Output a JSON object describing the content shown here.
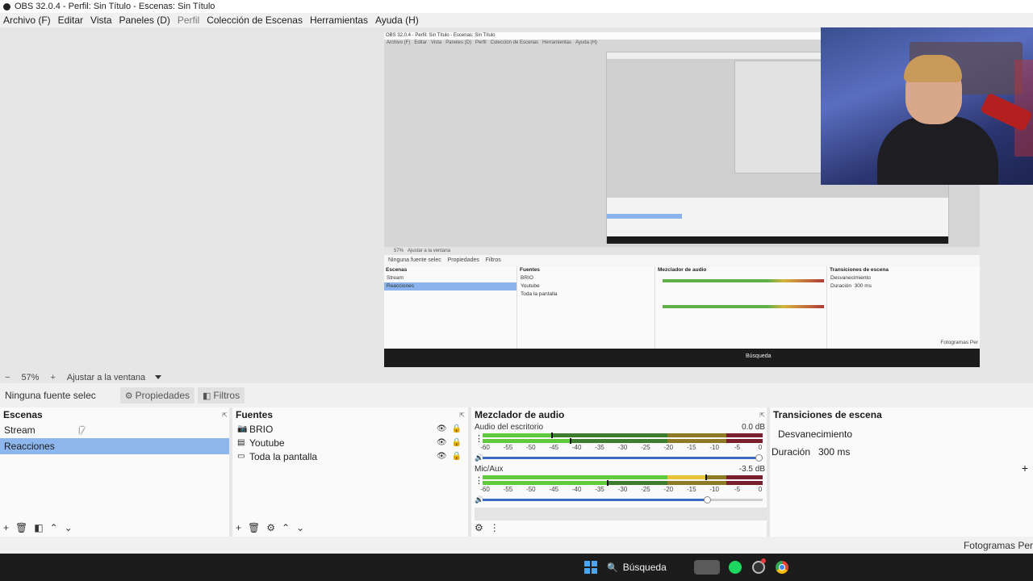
{
  "window": {
    "title": "OBS 32.0.4 - Perfil: Sin Título - Escenas: Sin Título"
  },
  "menu": [
    {
      "label": "Archivo (F)",
      "disabled": false
    },
    {
      "label": "Editar",
      "disabled": false
    },
    {
      "label": "Vista",
      "disabled": false
    },
    {
      "label": "Paneles (D)",
      "disabled": false
    },
    {
      "label": "Perfil",
      "disabled": true
    },
    {
      "label": "Colección de Escenas",
      "disabled": false
    },
    {
      "label": "Herramientas",
      "disabled": false
    },
    {
      "label": "Ayuda (H)",
      "disabled": false
    }
  ],
  "preview": {
    "nested": {
      "title": "OBS 32.0.4 - Perfil: Sin Título - Escenas: Sin Título",
      "menu": [
        "Archivo (F)",
        "Editar",
        "Vista",
        "Paneles (D)",
        "Perfil",
        "Colección de Escenas",
        "Herramientas",
        "Ayuda (H)"
      ],
      "zoom": "57%",
      "fit": "Ajustar a la ventana",
      "no_source": "Ninguna fuente selec",
      "properties": "Propiedades",
      "filters": "Filtros",
      "scenes_title": "Escenas",
      "scenes": [
        "Stream",
        "Reacciones"
      ],
      "sources_title": "Fuentes",
      "sources": [
        "BRIO",
        "Youtube",
        "Toda la pantalla"
      ],
      "mixer_title": "Mezclador de audio",
      "transitions_title": "Transiciones de escena",
      "transition": "Desvanecimiento",
      "duration": "Duración",
      "duration_value": "300 ms",
      "search": "Búsqueda",
      "fps": "Fotogramas Per"
    }
  },
  "zoombar": {
    "minus": "−",
    "zoom": "57%",
    "plus": "+",
    "fit_label": "Ajustar a la ventana"
  },
  "context_bar": {
    "no_source": "Ninguna fuente selec",
    "properties": "Propiedades",
    "filters": "Filtros"
  },
  "scenes": {
    "title": "Escenas",
    "items": [
      {
        "label": "Stream",
        "selected": false
      },
      {
        "label": "Reacciones",
        "selected": true
      }
    ]
  },
  "sources": {
    "title": "Fuentes",
    "items": [
      {
        "label": "BRIO",
        "icon": "camera-icon"
      },
      {
        "label": "Youtube",
        "icon": "browser-icon"
      },
      {
        "label": "Toda la pantalla",
        "icon": "display-icon"
      }
    ]
  },
  "mixer": {
    "title": "Mezclador de audio",
    "ticks": [
      "-60",
      "-55",
      "-50",
      "-45",
      "-40",
      "-35",
      "-30",
      "-25",
      "-20",
      "-15",
      "-10",
      "-5",
      "0"
    ],
    "channels": [
      {
        "name": "Audio del escritorio",
        "db": "0.0 dB",
        "level_top_db": -45,
        "level_bottom_db": -41,
        "volume": 1.0
      },
      {
        "name": "Mic/Aux",
        "db": "-3.5 dB",
        "level_top_db": -12,
        "level_bottom_db": -33,
        "volume": 0.8
      }
    ]
  },
  "transitions": {
    "title": "Transiciones de escena",
    "selected": "Desvanecimiento",
    "duration_label": "Duración",
    "duration_value": "300 ms"
  },
  "statusbar": {
    "fps_label": "Fotogramas Per"
  },
  "taskbar": {
    "search": "Búsqueda"
  },
  "colors": {
    "selection": "#8cb6ec",
    "meter_green": "#5fcb3c",
    "meter_yellow": "#e8c23a",
    "meter_red": "#d53a4a",
    "slider": "#3a6cc4"
  }
}
